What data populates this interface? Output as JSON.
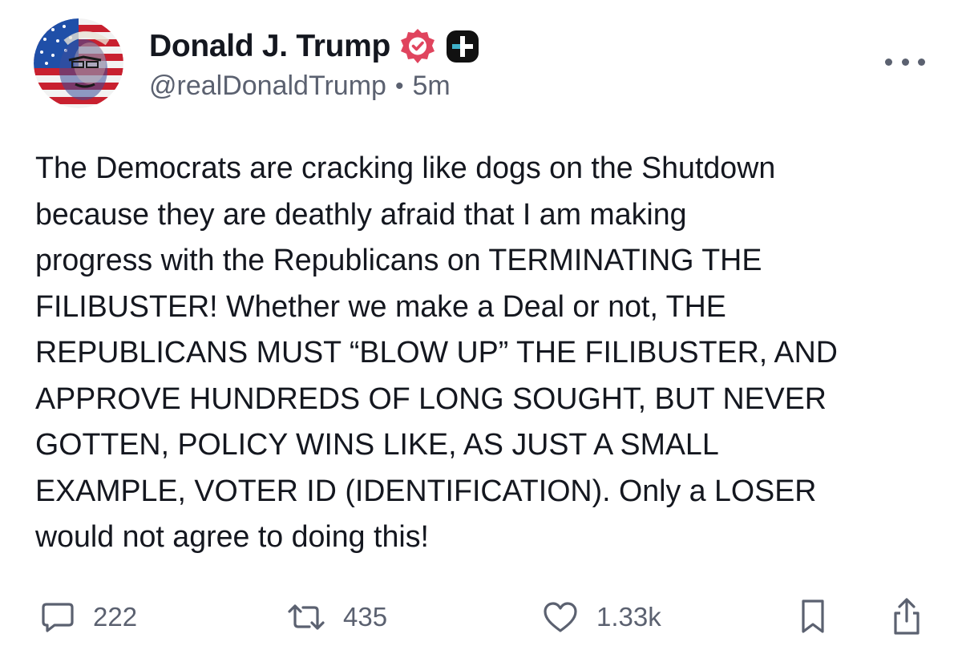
{
  "author": {
    "display_name": "Donald J. Trump",
    "handle": "@realDonaldTrump",
    "separator": "•",
    "time": "5m",
    "verified_icon": "verified-badge-icon",
    "extra_badge_icon": "plus-badge-icon",
    "avatar": "avatar-image"
  },
  "post": {
    "text": "The Democrats are cracking like dogs on the Shutdown\nbecause they are deathly afraid that I am making\nprogress with the Republicans on TERMINATING THE\nFILIBUSTER! Whether we make a Deal or not, THE\nREPUBLICANS MUST “BLOW UP” THE FILIBUSTER, AND\nAPPROVE HUNDREDS OF LONG SOUGHT, BUT NEVER\nGOTTEN, POLICY WINS LIKE, AS JUST A SMALL\nEXAMPLE, VOTER ID (IDENTIFICATION). Only a LOSER\nwould not agree to doing this!"
  },
  "actions": {
    "replies": "222",
    "reposts": "435",
    "likes": "1.33k",
    "icons": [
      "reply-icon",
      "repost-icon",
      "heart-icon",
      "bookmark-icon",
      "share-icon"
    ]
  },
  "colors": {
    "text": "#14171f",
    "muted": "#5b6170",
    "verified": "#e0445e",
    "badge": "#111111",
    "badge_accent": "#3fb1c9"
  }
}
